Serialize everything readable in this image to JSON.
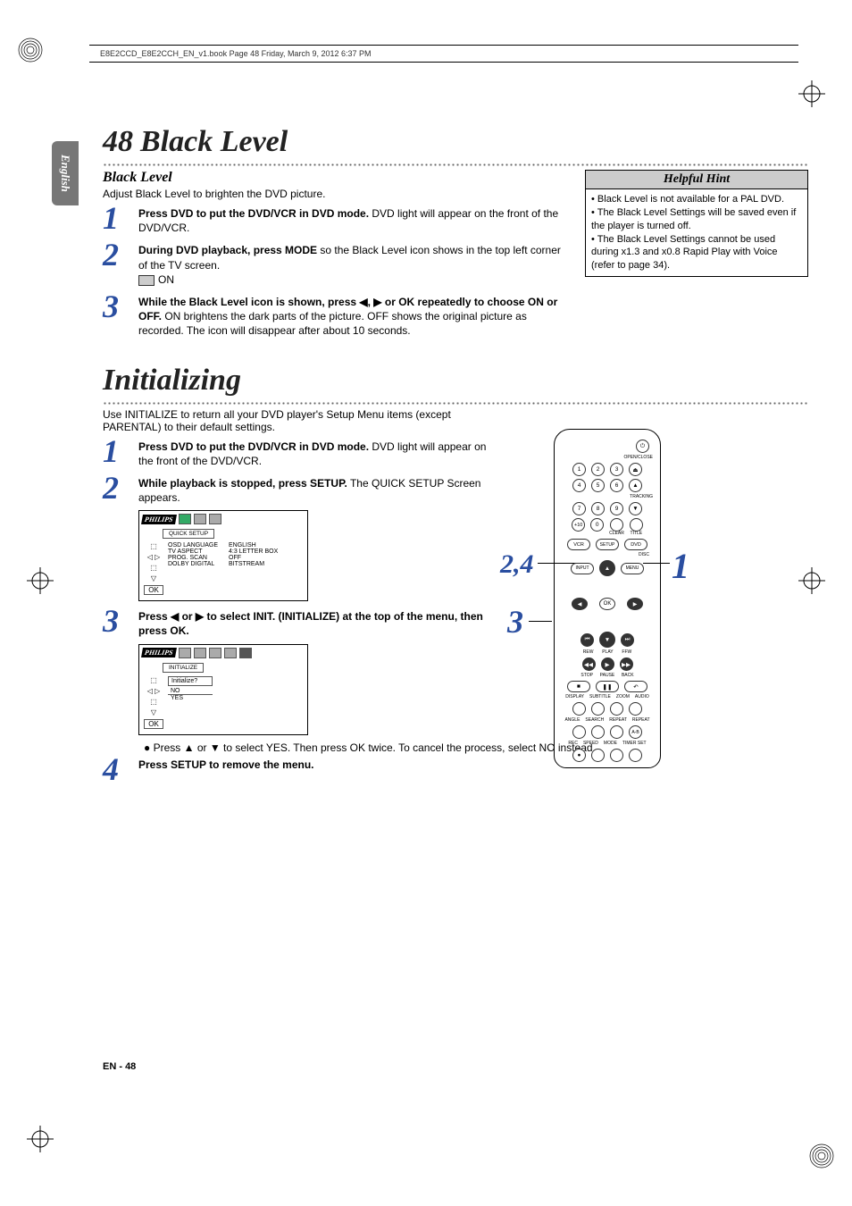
{
  "meta": {
    "header_text": "E8E2CCD_E8E2CCH_EN_v1.book  Page 48  Friday, March 9, 2012  6:37 PM",
    "side_tab": "English",
    "page_number": "48",
    "footer_en": "EN",
    "footer_sep": " - ",
    "footer_page": "48"
  },
  "black_level": {
    "title_num": "48",
    "title_text": "Black Level",
    "subhead": "Black Level",
    "intro": "Adjust Black Level to brighten the DVD picture.",
    "steps": [
      {
        "n": "1",
        "bold": "Press DVD to put the DVD/VCR in DVD mode.",
        "rest": " DVD light will appear on the front of the DVD/VCR."
      },
      {
        "n": "2",
        "bold": "During DVD playback, press MODE",
        "rest": " so the Black Level icon shows in the top left corner of the TV screen.",
        "icon_label": "ON"
      },
      {
        "n": "3",
        "bold": "While the Black Level icon is shown, press ◀, ▶ or OK repeatedly to choose ON or OFF.",
        "rest": " ON brightens the dark parts of the picture. OFF shows the original picture as recorded. The icon will disappear after about 10 seconds."
      }
    ],
    "hint_title": "Helpful Hint",
    "hints": [
      "Black Level is not available for a PAL DVD.",
      "The Black Level Settings will be saved even if the player is turned off.",
      "The Black Level Settings cannot be used during x1.3 and x0.8 Rapid Play with Voice (refer to page 34)."
    ]
  },
  "initializing": {
    "title_text": "Initializing",
    "intro": "Use INITIALIZE to return all your DVD player's Setup Menu items (except PARENTAL) to their default settings.",
    "steps": [
      {
        "n": "1",
        "bold": "Press DVD to put the DVD/VCR in DVD mode.",
        "rest": " DVD light will appear on the front of the DVD/VCR."
      },
      {
        "n": "2",
        "bold": "While playback is stopped, press SETUP.",
        "rest": " The QUICK SETUP Screen appears."
      },
      {
        "n": "3",
        "bold": "Press ◀ or ▶ to select INIT. (INITIALIZE) at the top of the menu, then press OK.",
        "rest": ""
      },
      {
        "n": "4",
        "bold": "Press SETUP to remove the menu.",
        "rest": ""
      }
    ],
    "bullets": [
      "Press ▲ or ▼ to select YES. Then press OK twice. To cancel the process, select NO instead."
    ],
    "screen1": {
      "logo": "PHILIPS",
      "tab_label": "QUICK SETUP",
      "rows": [
        {
          "k": "OSD LANGUAGE",
          "v": "ENGLISH"
        },
        {
          "k": "TV ASPECT",
          "v": "4:3 LETTER BOX"
        },
        {
          "k": "PROG. SCAN",
          "v": "OFF"
        },
        {
          "k": "DOLBY DIGITAL",
          "v": "BITSTREAM"
        }
      ],
      "ok": "OK"
    },
    "screen2": {
      "logo": "PHILIPS",
      "tab_label": "INITIALIZE",
      "prompt": "Initialize?",
      "opt_no": "NO",
      "opt_yes": "YES",
      "ok": "OK"
    },
    "callouts": {
      "c24": "2,4",
      "c3": "3",
      "c1": "1"
    }
  },
  "remote": {
    "open_close": "OPEN/CLOSE",
    "tracking": "TRACKING",
    "clear": "CLEAR",
    "title": "TITLE",
    "plus10": "+10",
    "vcr": "VCR",
    "setup": "SETUP",
    "dvd": "DVD",
    "input": "INPUT",
    "disc_menu": "DISC MENU",
    "ok": "OK",
    "rew": "REW",
    "play": "PLAY",
    "ffw": "FFW",
    "stop": "STOP",
    "pause": "PAUSE",
    "back": "BACK",
    "display": "DISPLAY",
    "subtitle": "SUBTITLE",
    "zoom": "ZOOM",
    "audio": "AUDIO",
    "angle": "ANGLE",
    "search": "SEARCH",
    "repeat": "REPEAT",
    "repeat_ab": "REPEAT",
    "ab": "A-B",
    "rec": "REC",
    "speed": "SPEED",
    "mode": "MODE",
    "timer": "TIMER SET",
    "nums": [
      "1",
      "2",
      "3",
      "4",
      "5",
      "6",
      "7",
      "8",
      "9",
      "0"
    ]
  }
}
